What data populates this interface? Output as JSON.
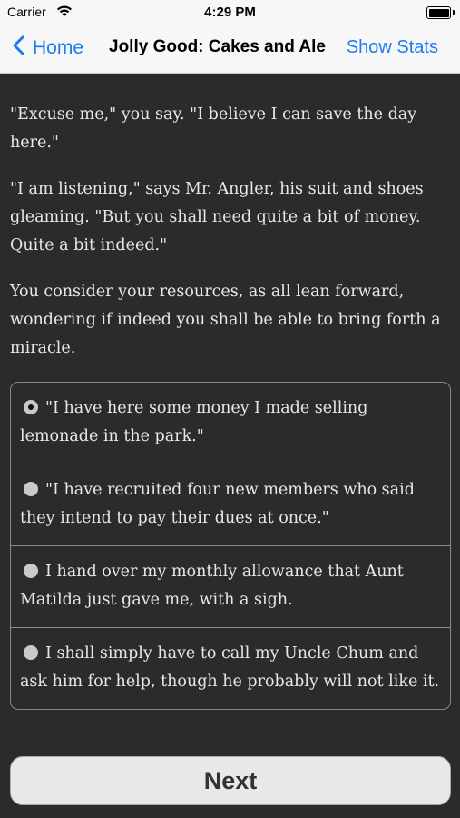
{
  "status_bar": {
    "carrier": "Carrier",
    "time": "4:29 PM",
    "wifi_icon": "wifi-icon",
    "battery_icon": "battery-icon"
  },
  "nav": {
    "back_label": "Home",
    "back_icon": "chevron-left-icon",
    "title": "Jolly Good: Cakes and Ale",
    "stats_label": "Show Stats",
    "accent_color": "#1a7cf5"
  },
  "story": {
    "paragraphs": [
      "\"Excuse me,\" you say. \"I believe I can save the day here.\"",
      "\"I am listening,\" says Mr. Angler, his suit and shoes gleaming. \"But you shall need quite a bit of money. Quite a bit indeed.\"",
      "You consider your resources, as all lean forward, wondering if indeed you shall be able to bring forth a miracle."
    ]
  },
  "choices": [
    {
      "label": "\"I have here some money I made selling lemonade in the park.\"",
      "selected": true
    },
    {
      "label": "\"I have recruited four new members who said they intend to pay their dues at once.\"",
      "selected": false
    },
    {
      "label": "I hand over my monthly allowance that Aunt Matilda just gave me, with a sigh.",
      "selected": false
    },
    {
      "label": "I shall simply have to call my Uncle Chum and ask him for help, though he probably will not like it.",
      "selected": false
    }
  ],
  "next_label": "Next"
}
